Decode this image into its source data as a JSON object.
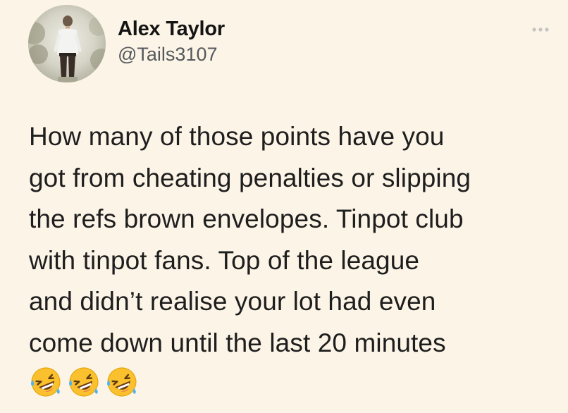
{
  "author": {
    "display_name": "Alex Taylor",
    "handle": "@Tails3107"
  },
  "menu": {
    "icon": "more-horizontal-icon"
  },
  "tweet": {
    "lines": [
      "How many of those points have you",
      "got from cheating penalties or slipping",
      "the refs brown envelopes. Tinpot club",
      "with tinpot fans. Top of the league",
      "and didn’t realise your lot had even",
      "come down until the last 20 minutes"
    ],
    "emojis": [
      "rolling-on-the-floor-laughing",
      "rolling-on-the-floor-laughing",
      "rolling-on-the-floor-laughing"
    ]
  },
  "colors": {
    "background": "#fcf4e6",
    "text": "#1e1e1e",
    "handle": "#54595d",
    "menu_dots": "#c8c8c8",
    "emoji_yellow": "#fbc02d"
  }
}
